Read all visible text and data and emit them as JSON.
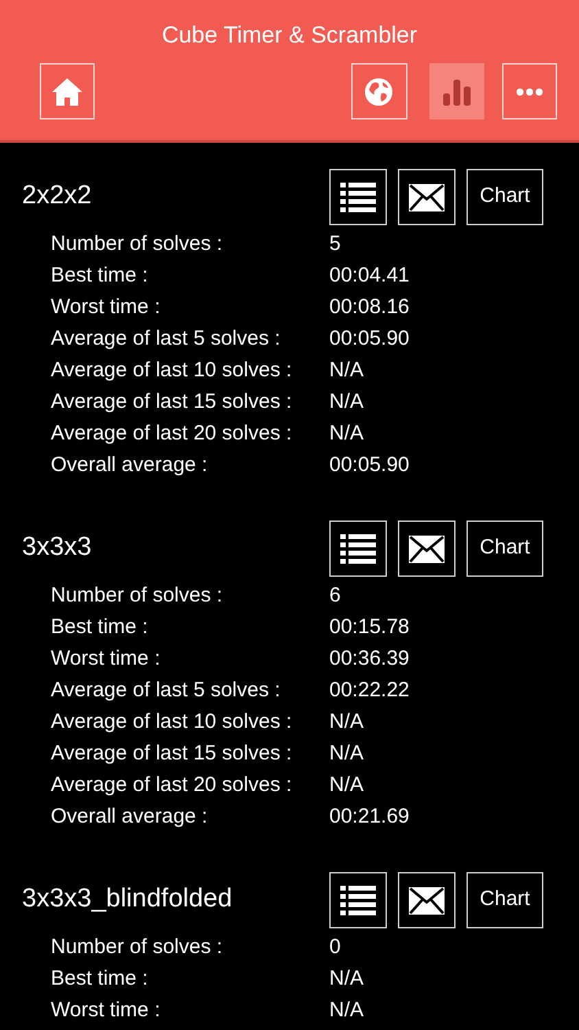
{
  "header": {
    "title": "Cube Timer & Scrambler",
    "nav": [
      {
        "kind": "home",
        "selected": false
      },
      {
        "kind": "globe",
        "selected": false
      },
      {
        "kind": "stats",
        "selected": true
      },
      {
        "kind": "more",
        "selected": false
      }
    ]
  },
  "puzzles": [
    {
      "name": "2x2x2",
      "chart_button": "Chart",
      "stats": [
        {
          "label": "Number of solves :",
          "value": "5"
        },
        {
          "label": "Best time :",
          "value": "00:04.41"
        },
        {
          "label": "Worst time :",
          "value": "00:08.16"
        },
        {
          "label": "Average of last 5 solves :",
          "value": "00:05.90"
        },
        {
          "label": "Average of last 10 solves :",
          "value": "N/A"
        },
        {
          "label": "Average of last 15 solves :",
          "value": "N/A"
        },
        {
          "label": "Average of last 20 solves :",
          "value": "N/A"
        },
        {
          "label": "Overall average :",
          "value": "00:05.90"
        }
      ]
    },
    {
      "name": "3x3x3",
      "chart_button": "Chart",
      "stats": [
        {
          "label": "Number of solves :",
          "value": "6"
        },
        {
          "label": "Best time :",
          "value": "00:15.78"
        },
        {
          "label": "Worst time :",
          "value": "00:36.39"
        },
        {
          "label": "Average of last 5 solves :",
          "value": "00:22.22"
        },
        {
          "label": "Average of last 10 solves :",
          "value": "N/A"
        },
        {
          "label": "Average of last 15 solves :",
          "value": "N/A"
        },
        {
          "label": "Average of last 20 solves :",
          "value": "N/A"
        },
        {
          "label": "Overall average :",
          "value": "00:21.69"
        }
      ]
    },
    {
      "name": "3x3x3_blindfolded",
      "chart_button": "Chart",
      "stats": [
        {
          "label": "Number of solves :",
          "value": "0"
        },
        {
          "label": "Best time :",
          "value": "N/A"
        },
        {
          "label": "Worst time :",
          "value": "N/A"
        }
      ]
    }
  ]
}
